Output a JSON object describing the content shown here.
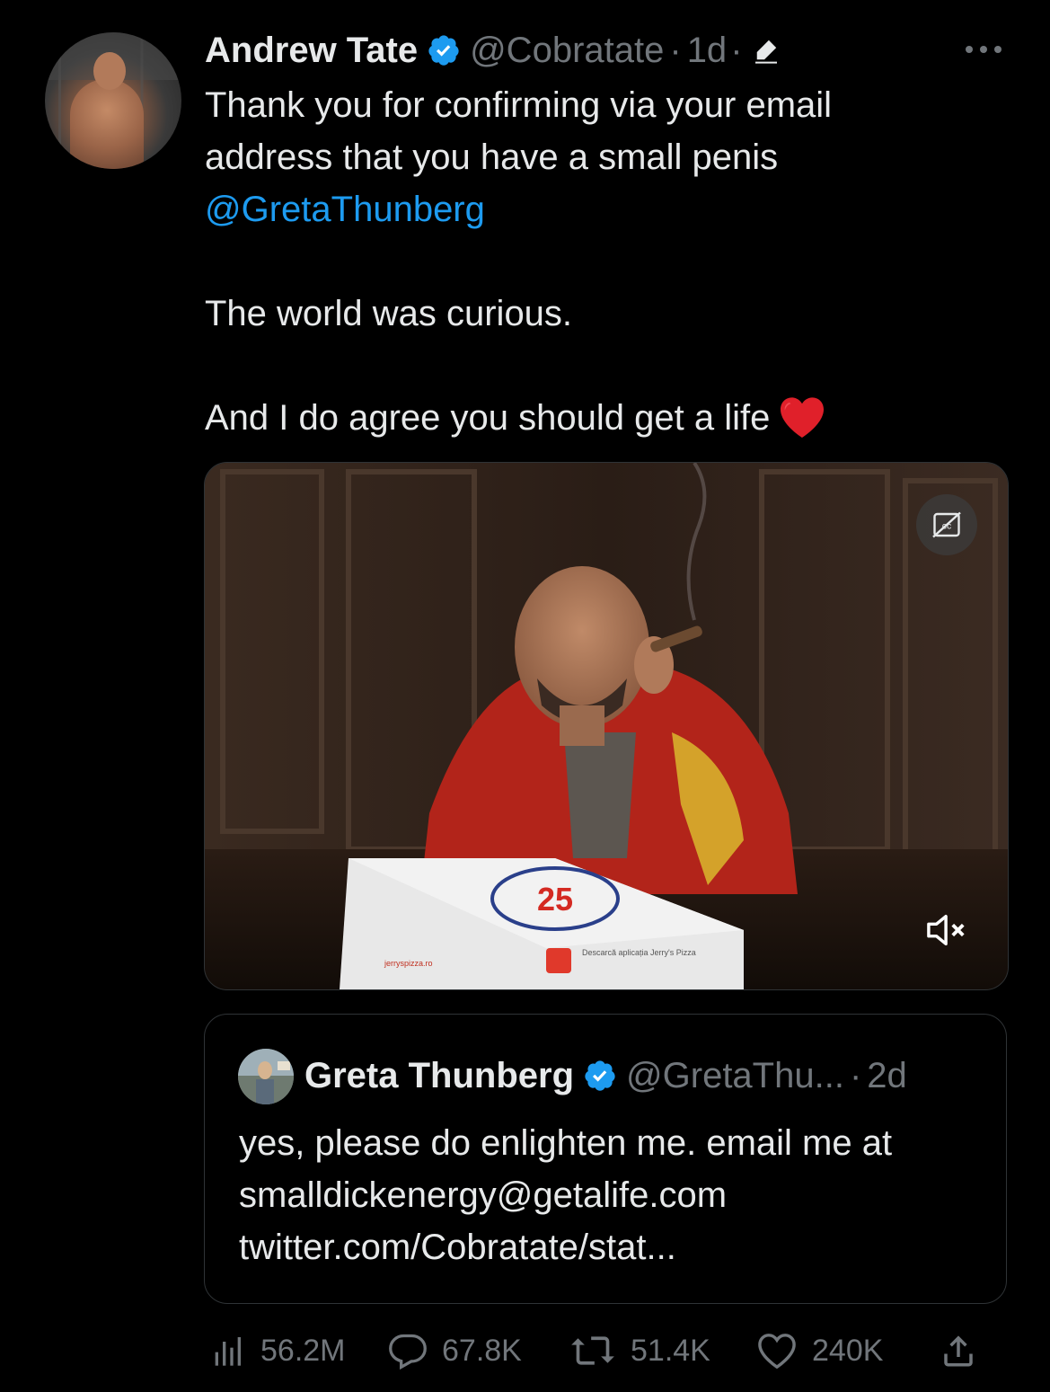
{
  "tweet": {
    "author_name": "Andrew Tate",
    "author_handle": "@Cobratate",
    "separator": "·",
    "time": "1d",
    "text_line1": "Thank you for confirming via your email",
    "text_line2": "address that you have a small penis",
    "mention": "@GretaThunberg",
    "text_para2": "The world was curious.",
    "text_para3": "And I do agree you should get a life",
    "emoji": "heart-emoji"
  },
  "media": {
    "type": "video",
    "caption_icon": "closed-captions-off-icon",
    "mute_icon": "speaker-muted-icon",
    "pizza_box_text": "Descarcă aplicația Jerry's Pizza",
    "pizza_box_brand": "jerryspizza.ro"
  },
  "quoted_tweet": {
    "author_name": "Greta Thunberg",
    "author_handle": "@GretaThu...",
    "separator": "·",
    "time": "2d",
    "text_line1": "yes, please do enlighten me. email me at",
    "text_line2": "smalldickenergy@getalife.com",
    "text_line3": "twitter.com/Cobratate/stat..."
  },
  "actions": {
    "views": "56.2M",
    "replies": "67.8K",
    "retweets": "51.4K",
    "likes": "240K"
  },
  "colors": {
    "background": "#000000",
    "text": "#e7e9ea",
    "muted": "#71767b",
    "accent": "#1d9bf0",
    "border": "#2f3336",
    "heart": "#e0202a"
  }
}
